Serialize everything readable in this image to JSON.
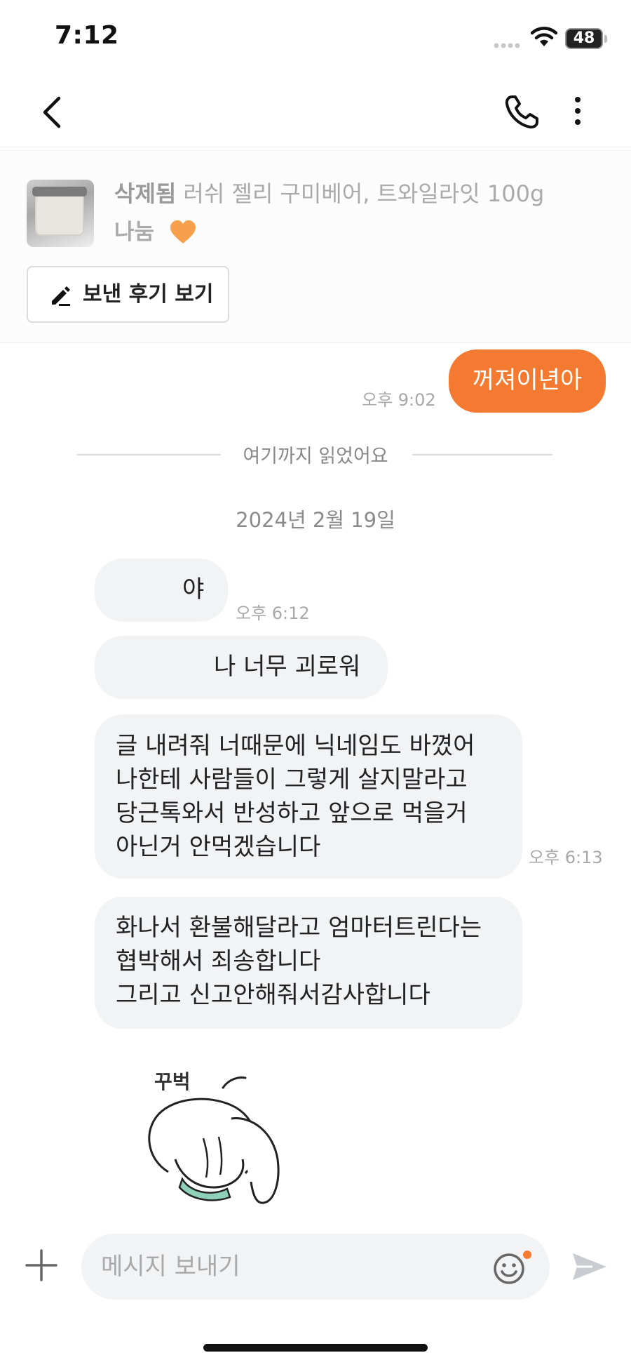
{
  "status_bar": {
    "time": "7:12",
    "battery": "48"
  },
  "nav": {
    "back_icon": "chevron-left-icon",
    "call_icon": "phone-icon",
    "menu_icon": "more-vertical-icon"
  },
  "product": {
    "status": "삭제됨",
    "name": "러쉬 젤리 구미베어, 트와일라잇 100g",
    "price": "나눔",
    "heart_color": "#f6a04d",
    "review_button": "보낸 후기 보기"
  },
  "messages": {
    "outgoing_1": {
      "text": "꺼져이년아",
      "time": "오후 9:02"
    },
    "divider": "여기까지 읽었어요",
    "date": "2024년 2월 19일",
    "incoming_1": {
      "text": "야",
      "time": "오후 6:12"
    },
    "incoming_2": {
      "text": "나 너무 괴로워"
    },
    "incoming_3": {
      "lines": [
        "글 내려줘 너때문에 닉네임도 바꼈어",
        "나한테 사람들이 그렇게 살지말라고",
        "당근톡와서 반성하고 앞으로 먹을거",
        "아닌거 안먹겠습니다"
      ],
      "time": "오후 6:13"
    },
    "incoming_4": {
      "lines": [
        "화나서 환불해달라고 엄마터트린다는",
        "협박해서 죄송합니다",
        "그리고 신고안해줘서감사합니다"
      ]
    },
    "sticker_label": "꾸벅"
  },
  "input": {
    "placeholder": "메시지 보내기"
  },
  "colors": {
    "accent": "#f47a32",
    "bubble_in": "#f2f3f5"
  }
}
